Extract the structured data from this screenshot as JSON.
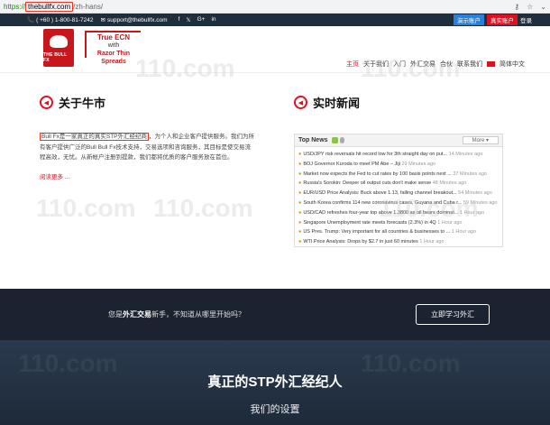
{
  "browser": {
    "scheme": "https://",
    "host": "thebullfx.com",
    "path": "/zh-hans/",
    "icons": [
      "key-icon",
      "star-icon",
      "menu-icon"
    ]
  },
  "topbar": {
    "phone": "( +60 ) 1-800-81-7242",
    "email": "support@thebullfx.com",
    "social": [
      "f",
      "𝕏",
      "G+",
      "in"
    ],
    "demo": "演示账户",
    "live": "真实账户",
    "login": "登录"
  },
  "logo": {
    "text": "THE BULL FX"
  },
  "tagline": {
    "line1": "True ECN",
    "line2": "with",
    "line3": "Razor Thin Spreads"
  },
  "nav": [
    "主页",
    "关于我们",
    "入门",
    "外汇交易",
    "合伙",
    "联系我们",
    "简体中文"
  ],
  "about": {
    "title": "关于牛市",
    "text_highlight": "Bull Fx是一家真正的真实STP外汇经纪商",
    "text_rest": "，为个人和企业客户提供服务。我们为所有客户提供广泛的Bull Bull Fx技术支持，交易选项和咨询服务，其目标是使交易流程高效，无忧。从新帐户注册到提款，我们都将优质的客户服务放在首位。",
    "readmore": "阅读更多 ..."
  },
  "news": {
    "title": "实时新闻",
    "box_title": "Top News",
    "more": "More",
    "items": [
      {
        "text": "USD/JPY risk reversals hit record low for 3th straight day on put...",
        "time": "14 Minutes ago"
      },
      {
        "text": "BOJ Governor Kuroda to meet PM Abe – Jiji",
        "time": "29 Minutes ago"
      },
      {
        "text": "Market now expects the Fed to cut rates by 100 basis points next ...",
        "time": "37 Minutes ago"
      },
      {
        "text": "Russia's Sorokin: Deeper oil output cuts don't make sense",
        "time": "48 Minutes ago"
      },
      {
        "text": "EUR/USD Price Analysis: Buck above 1.13, falling channel breakout...",
        "time": "54 Minutes ago"
      },
      {
        "text": "South Korea confirms 114 new coronavirus cases, Guyana and Cuba r...",
        "time": "59 Minutes ago"
      },
      {
        "text": "USD/CAD refreshes four-year top above 1.3800 as oil bears dominat...",
        "time": "1 Hour ago"
      },
      {
        "text": "Singapore Unemployment rate meets forecasts (2.3%) in 4Q",
        "time": "1 Hour ago"
      },
      {
        "text": "US Pres. Trump: Very important for all countries & businesses to ...",
        "time": "1 Hour ago"
      },
      {
        "text": "WTI Price Analysis: Drops by $2.7 in just 60 minutes",
        "time": "1 Hour ago"
      }
    ]
  },
  "banner": {
    "pre": "您是",
    "bold": "外汇交易",
    "post": "新手，不知道从哪里开始吗？",
    "button": "立即学习外汇"
  },
  "bottom": {
    "title": "真正的STP外汇经纪人",
    "subtitle": "我们的设置"
  },
  "watermark": "110.com",
  "colors": {
    "accent": "#d12",
    "topbar": "#1f2e3d",
    "banner": "#1c2330"
  }
}
